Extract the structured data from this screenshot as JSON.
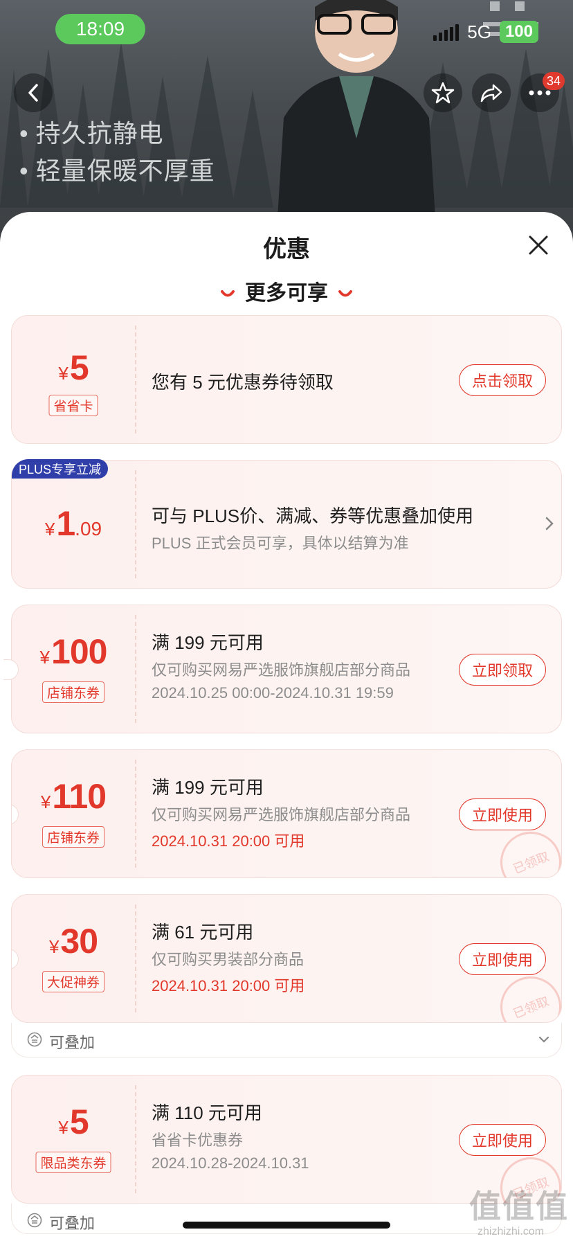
{
  "status_bar": {
    "time": "18:09",
    "network": "5G",
    "battery": "100"
  },
  "header": {
    "notification_count": "34"
  },
  "product": {
    "features": [
      "持久抗静电",
      "轻量保暖不厚重"
    ]
  },
  "sheet": {
    "title": "优惠",
    "section_title": "更多可享"
  },
  "colors": {
    "accent": "#e2382b",
    "plus": "#2f3ea8",
    "card_bg": "#fdf0ee"
  },
  "coupons": [
    {
      "currency": "¥",
      "amount": "5",
      "tag": "省省卡",
      "line1": "您有 5 元优惠券待领取",
      "action": "点击领取"
    },
    {
      "badge": "PLUS专享立减",
      "currency": "¥",
      "amount": "1",
      "amount_decimal": ".09",
      "line1": "可与 PLUS价、满减、券等优惠叠加使用",
      "line2": "PLUS 正式会员可享，具体以结算为准"
    },
    {
      "currency": "¥",
      "amount": "100",
      "tag": "店铺东券",
      "line1": "满 199 元可用",
      "line2": "仅可购买网易严选服饰旗舰店部分商品",
      "line3": "2024.10.25 00:00-2024.10.31 19:59",
      "action": "立即领取"
    },
    {
      "currency": "¥",
      "amount": "110",
      "tag": "店铺东券",
      "line1": "满 199 元可用",
      "line2": "仅可购买网易严选服饰旗舰店部分商品",
      "line3": "2024.10.31 20:00 可用",
      "action": "立即使用",
      "stamp": "已领取"
    },
    {
      "currency": "¥",
      "amount": "30",
      "tag": "大促神券",
      "line1": "满 61 元可用",
      "line2": "仅可购买男装部分商品",
      "line3": "2024.10.31 20:00 可用",
      "action": "立即使用",
      "stamp": "已领取",
      "stack_label": "可叠加"
    },
    {
      "currency": "¥",
      "amount": "5",
      "tag": "限品类东券",
      "line1": "满 110 元可用",
      "line2": "省省卡优惠券",
      "line3": "2024.10.28-2024.10.31",
      "action": "立即使用",
      "stamp": "已领取",
      "stack_label": "可叠加"
    }
  ],
  "watermark": {
    "text": "值值值",
    "sub": "zhizhizhi.com"
  }
}
